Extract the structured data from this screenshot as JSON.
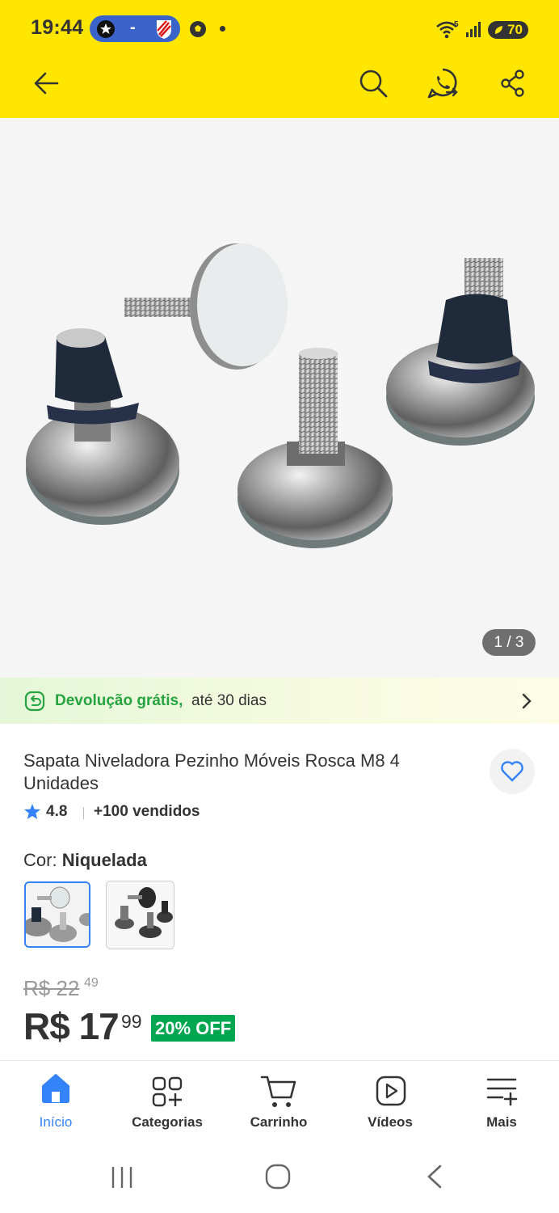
{
  "status_bar": {
    "time": "19:44",
    "score_separator": "-",
    "battery_level": "70",
    "network_label": "5"
  },
  "header": {
    "back": "back-arrow-icon",
    "search": "search-icon",
    "whatsapp": "whatsapp-icon",
    "share": "share-icon",
    "background": "#FFE600"
  },
  "gallery": {
    "counter": "1 / 3",
    "current_index": 1,
    "total": 3
  },
  "return_banner": {
    "strong": "Devolução grátis,",
    "rest": "até 30 dias",
    "color": "#27a441"
  },
  "product": {
    "title": "Sapata Niveladora Pezinho Móveis Rosca M8 4 Unidades",
    "rating": "4.8",
    "sold": "+100 vendidos",
    "color_label_prefix": "Cor:",
    "color_value": "Niquelada",
    "old_price": "R$ 22",
    "old_price_cents": "49",
    "price": "R$ 17",
    "price_cents": "99",
    "discount": "20% OFF"
  },
  "bottom_nav": {
    "items": [
      {
        "label": "Início",
        "icon": "home-icon",
        "active": true
      },
      {
        "label": "Categorias",
        "icon": "categories-icon",
        "active": false
      },
      {
        "label": "Carrinho",
        "icon": "cart-icon",
        "active": false
      },
      {
        "label": "Vídeos",
        "icon": "video-icon",
        "active": false
      },
      {
        "label": "Mais",
        "icon": "menu-icon",
        "active": false
      }
    ],
    "active_color": "#3483fa"
  }
}
